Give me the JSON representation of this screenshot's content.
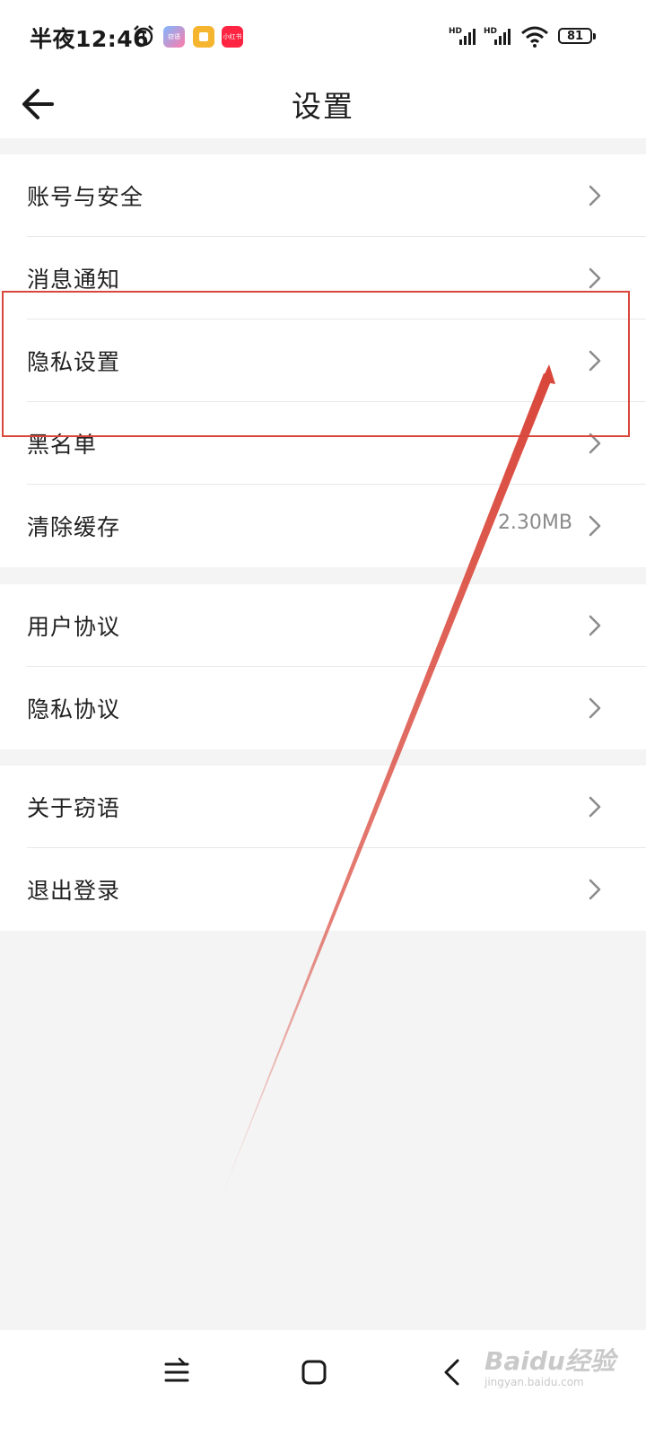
{
  "status_bar": {
    "time": "半夜12:46",
    "battery": "81",
    "network_1": "HD",
    "network_2": "HD",
    "app_badges": [
      "窃语",
      "小红书"
    ]
  },
  "header": {
    "title": "设置"
  },
  "groups": [
    {
      "items": [
        {
          "label": "账号与安全"
        },
        {
          "label": "消息通知"
        },
        {
          "label": "隐私设置"
        },
        {
          "label": "黑名单"
        },
        {
          "label": "清除缓存",
          "value": "2.30MB"
        }
      ]
    },
    {
      "items": [
        {
          "label": "用户协议"
        },
        {
          "label": "隐私协议"
        }
      ]
    },
    {
      "items": [
        {
          "label": "关于窃语"
        },
        {
          "label": "退出登录"
        }
      ]
    }
  ],
  "annotation": {
    "color": "#d9463a"
  },
  "watermark": {
    "main": "Baidu经验",
    "sub": "jingyan.baidu.com"
  }
}
